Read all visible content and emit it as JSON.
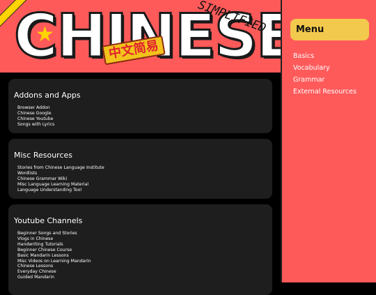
{
  "banner": {
    "title": "CHINESE",
    "script": "SIMPLIFIED",
    "badge": "中文简易"
  },
  "sidebar": {
    "menu_label": "Menu",
    "links": [
      "Basics",
      "Vocabulary",
      "Grammar",
      "External Resources"
    ]
  },
  "sections": [
    {
      "title": "Addons and Apps",
      "items": [
        "Browser Addon",
        "Chinese Google",
        "Chinese Youtube",
        "Songs with Lyrics"
      ]
    },
    {
      "title": "Misc Resources",
      "items": [
        "Stories from Chinese Language Institute",
        "Wordlists",
        "Chinese Grammar Wiki",
        "Misc Language Learning Material",
        "Language Understanding Tool"
      ]
    },
    {
      "title": "Youtube Channels",
      "items": [
        "Beginner Songs and Stories",
        "Vlogs in Chinese",
        "Handwriting Tutorials",
        "Beginner Chinese Course",
        "Basic Mandarin Lessons",
        "Misc Videos on Learning Mandarin",
        "Chinese Lessons",
        "Everyday Chinese",
        "Guided Mandarin"
      ]
    }
  ],
  "colors": {
    "banner_bg": "#ff5a5a",
    "sidebar_bg": "#ff5a5a",
    "menu_box": "#f2c94c",
    "card_bg": "#1e1e1e",
    "page_bg": "#000000"
  }
}
